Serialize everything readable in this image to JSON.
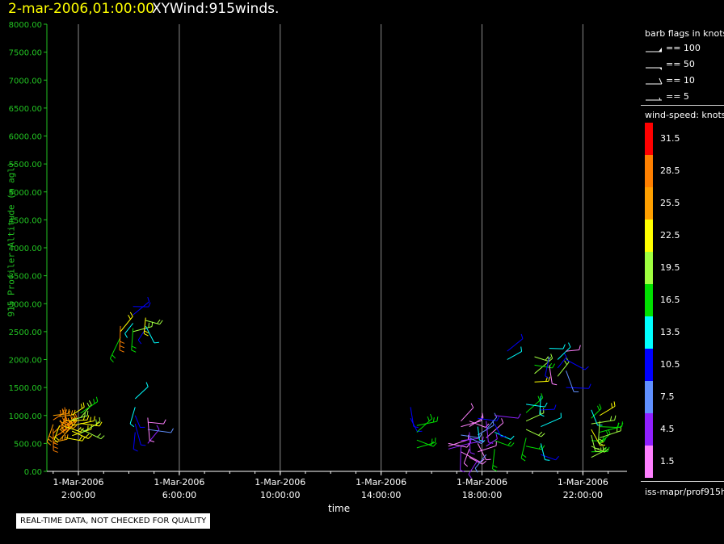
{
  "header": {
    "date_time": "2-mar-2006,01:00:00",
    "title": "XYWind:915winds."
  },
  "footer": {
    "note": "REAL-TIME DATA, NOT CHECKED FOR QUALITY",
    "source": "iss-mapr/prof915h"
  },
  "colors": {
    "axis": "#22c322",
    "grid": "#8a8a8a",
    "header_date": "#ffff00",
    "background": "#000000"
  },
  "chart_data": {
    "type": "scatter",
    "title": "XYWind:915winds.",
    "xlabel": "time",
    "ylabel": "915 Profiler Altitude (m agl)",
    "ylim": [
      0,
      8000
    ],
    "xlim": [
      "2006-03-01 00:45",
      "2006-03-01 23:45"
    ],
    "y_ticks": [
      "0.00",
      "500.00",
      "1000.00",
      "1500.00",
      "2000.00",
      "2500.00",
      "3000.00",
      "3500.00",
      "4000.00",
      "4500.00",
      "5000.00",
      "5500.00",
      "6000.00",
      "6500.00",
      "7000.00",
      "7500.00",
      "8000.00"
    ],
    "x_ticks": [
      {
        "date": "1-Mar-2006",
        "time": "2:00:00"
      },
      {
        "date": "1-Mar-2006",
        "time": "6:00:00"
      },
      {
        "date": "1-Mar-2006",
        "time": "10:00:00"
      },
      {
        "date": "1-Mar-2006",
        "time": "14:00:00"
      },
      {
        "date": "1-Mar-2006",
        "time": "18:00:00"
      },
      {
        "date": "1-Mar-2006",
        "time": "22:00:00"
      }
    ],
    "grid": "vertical lines at labeled times",
    "legend_position": "right",
    "barb_legend": {
      "title": "barb flags in knots",
      "entries": [
        {
          "label": "== 100",
          "symbol": "pennant"
        },
        {
          "label": "== 50",
          "symbol": "half-pennant"
        },
        {
          "label": "== 10",
          "symbol": "full-barb"
        },
        {
          "label": "== 5",
          "symbol": "half-barb"
        }
      ]
    },
    "colorbar": {
      "title": "wind-speed: knots",
      "entries": [
        {
          "label": "31.5",
          "color": "#ff0000"
        },
        {
          "label": "28.5",
          "color": "#ff8000"
        },
        {
          "label": "25.5",
          "color": "#ffa000"
        },
        {
          "label": "22.5",
          "color": "#ffff00"
        },
        {
          "label": "19.5",
          "color": "#a0ff40"
        },
        {
          "label": "16.5",
          "color": "#00e000"
        },
        {
          "label": "13.5",
          "color": "#00ffff"
        },
        {
          "label": "10.5",
          "color": "#0000ff"
        },
        {
          "label": "7.5",
          "color": "#6090ff"
        },
        {
          "label": "4.5",
          "color": "#9020ff"
        },
        {
          "label": "1.5",
          "color": "#ff80ff"
        }
      ]
    },
    "series": [
      {
        "time": "2006-03-01 01:00",
        "points": [
          [
            520,
            25.5
          ],
          [
            600,
            28.5
          ],
          [
            680,
            28.5
          ],
          [
            760,
            28.5
          ],
          [
            840,
            25.5
          ],
          [
            920,
            28.5
          ],
          [
            1000,
            25.5
          ]
        ]
      },
      {
        "time": "2006-03-01 01:15",
        "points": [
          [
            560,
            25.5
          ],
          [
            660,
            28.5
          ],
          [
            740,
            25.5
          ],
          [
            820,
            22.5
          ],
          [
            900,
            25.5
          ],
          [
            980,
            25.5
          ]
        ]
      },
      {
        "time": "2006-03-01 01:30",
        "points": [
          [
            600,
            22.5
          ],
          [
            700,
            25.5
          ],
          [
            800,
            22.5
          ],
          [
            900,
            22.5
          ],
          [
            1000,
            25.5
          ],
          [
            1080,
            28.5
          ]
        ]
      },
      {
        "time": "2006-03-01 01:45",
        "points": [
          [
            640,
            22.5
          ],
          [
            720,
            22.5
          ],
          [
            820,
            22.5
          ],
          [
            920,
            19.5
          ],
          [
            1010,
            22.5
          ]
        ]
      },
      {
        "time": "2006-03-01 02:05",
        "points": [
          [
            680,
            19.5
          ],
          [
            760,
            19.5
          ],
          [
            860,
            22.5
          ],
          [
            960,
            19.5
          ],
          [
            1040,
            16.5
          ]
        ]
      },
      {
        "time": "2006-03-01 03:40",
        "points": [
          [
            2400,
            16.5
          ],
          [
            2500,
            22.5
          ],
          [
            2600,
            28.5
          ]
        ]
      },
      {
        "time": "2006-03-01 04:10",
        "points": [
          [
            2500,
            19.5
          ],
          [
            2560,
            16.5
          ],
          [
            2650,
            13.5
          ],
          [
            2800,
            10.5
          ],
          [
            2950,
            10.5
          ]
        ]
      },
      {
        "time": "2006-03-01 04:40",
        "points": [
          [
            2550,
            10.5
          ],
          [
            2600,
            13.5
          ],
          [
            2700,
            19.5
          ],
          [
            2750,
            22.5
          ]
        ]
      },
      {
        "time": "2006-03-01 04:15",
        "points": [
          [
            700,
            10.5
          ],
          [
            850,
            10.5
          ],
          [
            1000,
            10.5
          ],
          [
            1150,
            13.5
          ],
          [
            1300,
            13.5
          ]
        ]
      },
      {
        "time": "2006-03-01 04:45",
        "points": [
          [
            500,
            4.5
          ],
          [
            750,
            7.5
          ],
          [
            880,
            1.5
          ],
          [
            960,
            1.5
          ]
        ]
      },
      {
        "time": "2006-03-01 15:10",
        "points": [
          [
            950,
            10.5
          ],
          [
            1150,
            10.5
          ]
        ]
      },
      {
        "time": "2006-03-01 15:25",
        "points": [
          [
            420,
            16.5
          ],
          [
            560,
            16.5
          ],
          [
            700,
            16.5
          ],
          [
            820,
            16.5
          ]
        ]
      },
      {
        "time": "2006-03-01 16:40",
        "points": [
          [
            400,
            4.5
          ],
          [
            450,
            1.5
          ],
          [
            500,
            1.5
          ]
        ]
      },
      {
        "time": "2006-03-01 17:10",
        "points": [
          [
            350,
            1.5
          ],
          [
            450,
            4.5
          ],
          [
            550,
            4.5
          ],
          [
            650,
            7.5
          ],
          [
            800,
            1.5
          ],
          [
            900,
            1.5
          ]
        ]
      },
      {
        "time": "2006-03-01 17:30",
        "points": [
          [
            250,
            1.5
          ],
          [
            400,
            1.5
          ],
          [
            500,
            4.5
          ],
          [
            600,
            7.5
          ],
          [
            700,
            4.5
          ],
          [
            800,
            1.5
          ],
          [
            900,
            1.5
          ]
        ]
      },
      {
        "time": "2006-03-01 17:50",
        "points": [
          [
            200,
            4.5
          ],
          [
            350,
            1.5
          ],
          [
            500,
            1.5
          ],
          [
            650,
            7.5
          ],
          [
            800,
            13.5
          ],
          [
            950,
            10.5
          ]
        ]
      },
      {
        "time": "2006-03-01 18:10",
        "points": [
          [
            300,
            7.5
          ],
          [
            450,
            4.5
          ],
          [
            600,
            1.5
          ],
          [
            750,
            7.5
          ],
          [
            900,
            4.5
          ]
        ]
      },
      {
        "time": "2006-03-01 18:30",
        "points": [
          [
            400,
            16.5
          ],
          [
            550,
            16.5
          ],
          [
            700,
            13.5
          ],
          [
            850,
            10.5
          ],
          [
            1000,
            4.5
          ]
        ]
      },
      {
        "time": "2006-03-01 19:00",
        "points": [
          [
            2000,
            13.5
          ],
          [
            2150,
            10.5
          ]
        ]
      },
      {
        "time": "2006-03-01 19:45",
        "points": [
          [
            450,
            16.5
          ],
          [
            600,
            16.5
          ],
          [
            750,
            19.5
          ],
          [
            900,
            19.5
          ],
          [
            1050,
            16.5
          ],
          [
            1200,
            13.5
          ]
        ]
      },
      {
        "time": "2006-03-01 20:05",
        "points": [
          [
            1600,
            22.5
          ],
          [
            1750,
            19.5
          ],
          [
            1900,
            16.5
          ],
          [
            2050,
            19.5
          ]
        ]
      },
      {
        "time": "2006-03-01 20:20",
        "points": [
          [
            300,
            10.5
          ],
          [
            500,
            13.5
          ],
          [
            800,
            13.5
          ],
          [
            1100,
            10.5
          ],
          [
            1350,
            13.5
          ]
        ]
      },
      {
        "time": "2006-03-01 20:40",
        "points": [
          [
            1900,
            1.5
          ],
          [
            2050,
            10.5
          ],
          [
            2200,
            13.5
          ]
        ]
      },
      {
        "time": "2006-03-01 21:00",
        "points": [
          [
            1700,
            19.5
          ],
          [
            1850,
            10.5
          ],
          [
            2000,
            13.5
          ]
        ]
      },
      {
        "time": "2006-03-01 21:20",
        "points": [
          [
            1500,
            10.5
          ],
          [
            1800,
            7.5
          ],
          [
            2000,
            10.5
          ],
          [
            2150,
            1.5
          ]
        ]
      },
      {
        "time": "2006-03-01 22:20",
        "points": [
          [
            250,
            19.5
          ],
          [
            350,
            16.5
          ],
          [
            450,
            19.5
          ],
          [
            550,
            16.5
          ],
          [
            650,
            19.5
          ],
          [
            750,
            22.5
          ],
          [
            850,
            19.5
          ],
          [
            950,
            16.5
          ],
          [
            1100,
            13.5
          ]
        ]
      },
      {
        "time": "2006-03-01 22:40",
        "points": [
          [
            500,
            16.5
          ],
          [
            600,
            19.5
          ],
          [
            700,
            16.5
          ],
          [
            800,
            16.5
          ],
          [
            900,
            19.5
          ],
          [
            1000,
            22.5
          ]
        ]
      }
    ]
  }
}
